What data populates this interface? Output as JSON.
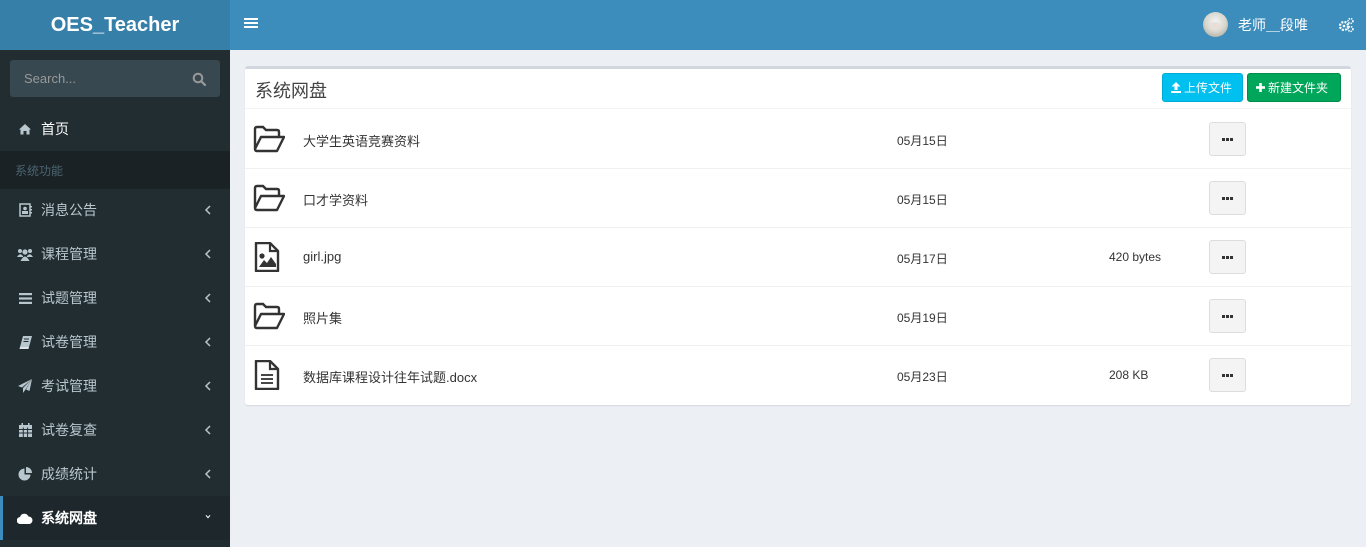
{
  "app": {
    "title": "OES_Teacher"
  },
  "header": {
    "user_name": "老师＿段唯"
  },
  "sidebar": {
    "search_placeholder": "Search...",
    "home": {
      "label": "首页",
      "icon": "home-icon"
    },
    "section_header": "系统功能",
    "items": [
      {
        "label": "消息公告",
        "icon": "contact-card-icon",
        "expanded": false
      },
      {
        "label": "课程管理",
        "icon": "users-icon",
        "expanded": false
      },
      {
        "label": "试题管理",
        "icon": "list-icon",
        "expanded": false
      },
      {
        "label": "试卷管理",
        "icon": "book-icon",
        "expanded": false
      },
      {
        "label": "考试管理",
        "icon": "paper-plane-icon",
        "expanded": false
      },
      {
        "label": "试卷复查",
        "icon": "calendar-icon",
        "expanded": false
      },
      {
        "label": "成绩统计",
        "icon": "pie-chart-icon",
        "expanded": false
      },
      {
        "label": "系统网盘",
        "icon": "cloud-icon",
        "expanded": true,
        "active": true
      }
    ]
  },
  "main": {
    "title": "系统网盘",
    "upload_label": "上传文件",
    "new_folder_label": "新建文件夹",
    "files": [
      {
        "name": "大学生英语竞赛资料",
        "type": "folder",
        "date": "05月15日",
        "size": ""
      },
      {
        "name": "口才学资料",
        "type": "folder",
        "date": "05月15日",
        "size": ""
      },
      {
        "name": "girl.jpg",
        "type": "image",
        "date": "05月17日",
        "size": "420 bytes"
      },
      {
        "name": "照片集",
        "type": "folder",
        "date": "05月19日",
        "size": ""
      },
      {
        "name": "数据库课程设计往年试题.docx",
        "type": "document",
        "date": "05月23日",
        "size": "208 KB"
      }
    ]
  },
  "colors": {
    "header": "#3c8dbc",
    "logo": "#367fa9",
    "sidebar": "#222d32",
    "upload_btn": "#00c0ef",
    "new_folder_btn": "#00a65a"
  }
}
